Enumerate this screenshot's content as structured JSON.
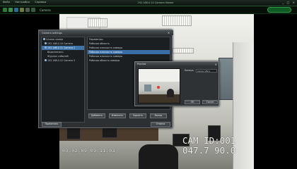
{
  "app": {
    "menu": [
      "Файл",
      "Настройки",
      "Справка"
    ],
    "title": "192.168.0.10 Camera Viewer",
    "window_buttons": [
      "_",
      "□",
      "×"
    ],
    "toolbar_label": "Camera"
  },
  "feed": {
    "timestamp": "03-02-09 09:11:03",
    "cam_id_line": "CAM ID:001",
    "coords_line": "047.7 90.0"
  },
  "dialog": {
    "title": "Camera settings",
    "tree": [
      {
        "label": "Список камер"
      },
      {
        "label": "192.168.0.10 Camera"
      },
      {
        "label": "192.168.0.11 Camera 2"
      },
      {
        "label": "Видеозапись"
      },
      {
        "label": "Журнал событий"
      },
      {
        "label": "192.168.0.12 Camera 3"
      }
    ],
    "list": [
      {
        "label": "Параметры"
      },
      {
        "label": "Рабочая область"
      },
      {
        "label": "Рабочая плоскость камеры"
      },
      {
        "label": "Рабочая плоскость камеры"
      },
      {
        "label": "Рабочая плоскость камеры"
      },
      {
        "label": "Рабочая область камеры"
      }
    ],
    "buttons": [
      "Добавить",
      "Изменить",
      "Удалить",
      "Выход"
    ],
    "bottom_buttons": [
      "Применить",
      "Отмена"
    ]
  },
  "preview": {
    "title": "Preview",
    "label": "Камера",
    "field_value": "Canon VB-C",
    "buttons": [
      "OK",
      "Cancel"
    ]
  },
  "colors": {
    "accent": "#2fa14a",
    "selection": "#3f74a8"
  }
}
